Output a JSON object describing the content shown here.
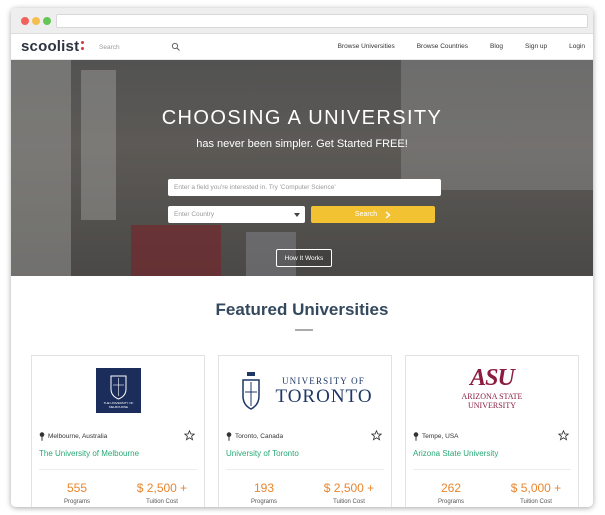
{
  "nav": {
    "logo": "scoolist",
    "search_placeholder": "Search",
    "links": [
      "Browse Universities",
      "Browse Countries",
      "Blog",
      "Sign up",
      "Login"
    ]
  },
  "hero": {
    "title": "CHOOSING A UNIVERSITY",
    "subtitle": "has never been simpler. Get Started FREE!",
    "field_placeholder": "Enter a field you're interested in. Try 'Computer Science'",
    "country_placeholder": "Enter Country",
    "search_button": "Search",
    "how_button": "How It Works"
  },
  "featured": {
    "title": "Featured Universities",
    "cards": [
      {
        "location": "Melbourne, Australia",
        "name": "The University of Melbourne",
        "logo_text": "THE UNIVERSITY OF MELBOURNE",
        "programs": "555",
        "programs_label": "Programs",
        "tuition": "$ 2,500 +",
        "tuition_label": "Tuition Cost"
      },
      {
        "location": "Toronto, Canada",
        "name": "University of Toronto",
        "logo_line1": "UNIVERSITY OF",
        "logo_line2": "TORONTO",
        "programs": "193",
        "programs_label": "Programs",
        "tuition": "$ 2,500 +",
        "tuition_label": "Tuition Cost"
      },
      {
        "location": "Tempe, USA",
        "name": "Arizona State University",
        "logo_mark": "ASU",
        "logo_line1": "ARIZONA STATE",
        "logo_line2": "UNIVERSITY",
        "programs": "262",
        "programs_label": "Programs",
        "tuition": "$ 5,000 +",
        "tuition_label": "Tuition Cost"
      }
    ]
  },
  "colors": {
    "accent_yellow": "#f3c232",
    "link_green": "#27a876",
    "stat_orange": "#e8862e",
    "heading": "#34495e",
    "melbourne_navy": "#1b2d5a",
    "toronto_navy": "#1e3765",
    "asu_maroon": "#8c1d40"
  },
  "icons": [
    "search-icon",
    "location-pin-icon",
    "star-outline-icon",
    "chevron-right-icon"
  ]
}
